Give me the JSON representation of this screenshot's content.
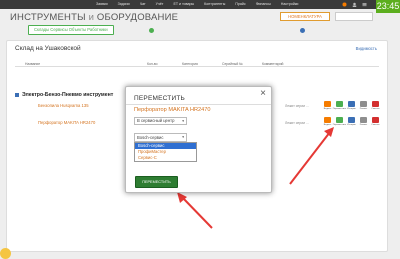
{
  "topbar": {
    "nav": [
      "Заявки",
      "Задачи",
      "Чат",
      "Учёт",
      "ЕТ и товары",
      "Контрагенты",
      "Прайс",
      "Финансы",
      "Настройки"
    ],
    "clock": "23:45"
  },
  "header": {
    "title_main": "ИНСТРУМЕНТЫ ",
    "title_amp": "и",
    "title_rest": " ОБОРУДОВАНИЕ",
    "sub_button": "Склады Сервисы Объекты Работники",
    "nomenclature_button": "НОМЕНКЛАТУРА"
  },
  "panel": {
    "title": "Склад на Ушаковской",
    "visibility_link": "Видимость",
    "columns": [
      "Название",
      "Кол-во",
      "Категория",
      "Серийный №",
      "Комментарий"
    ],
    "section": "Электро-Бензо-Пневмо инструмент",
    "items": [
      {
        "name": "Бензопила Husqvarna 135",
        "comment": "Лежит серии ..."
      },
      {
        "name": "Перфоратор MAKITA HR2470",
        "comment": "Лежит серии ..."
      }
    ],
    "row_actions": [
      "Выдать",
      "Переместить",
      "История",
      "Ремонт",
      "Списать"
    ]
  },
  "colors": {
    "accent_green": "#4caf50",
    "accent_orange": "#e0771f",
    "danger": "#d32f2f",
    "primary_blue": "#3b6fb5"
  },
  "modal": {
    "title": "ПЕРЕМЕСТИТЬ",
    "item": "Перфоратор MAKITA HR2470",
    "destination_type": "В сервисный центр",
    "service_selected": "Bosch-сервис",
    "options": [
      "Bosch-сервис",
      "ПрофиМастер",
      "Сервис-С"
    ],
    "submit": "ПЕРЕМЕСТИТЬ"
  }
}
